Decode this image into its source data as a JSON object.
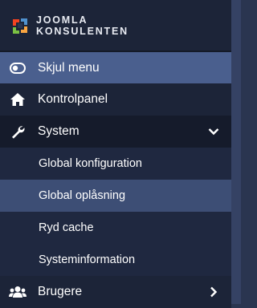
{
  "logo": {
    "line1": "JOOMLA",
    "line2": "KONSULENTEN"
  },
  "menu": {
    "toggle": {
      "label": "Skjul menu",
      "icon": "toggle-icon"
    },
    "control_panel": {
      "label": "Kontrolpanel",
      "icon": "home-icon"
    },
    "system": {
      "label": "System",
      "icon": "wrench-icon",
      "expanded": true,
      "items": [
        {
          "label": "Global konfiguration",
          "active": false
        },
        {
          "label": "Global oplåsning",
          "active": true
        },
        {
          "label": "Ryd cache",
          "active": false
        },
        {
          "label": "Systeminformation",
          "active": false
        }
      ]
    },
    "users": {
      "label": "Brugere",
      "icon": "users-icon"
    }
  },
  "colors": {
    "sidebar_bg": "#1c2438",
    "toggle_bg": "#4a5f8e",
    "active_sub_bg": "#3d4e75",
    "system_bg": "#151b2b"
  }
}
